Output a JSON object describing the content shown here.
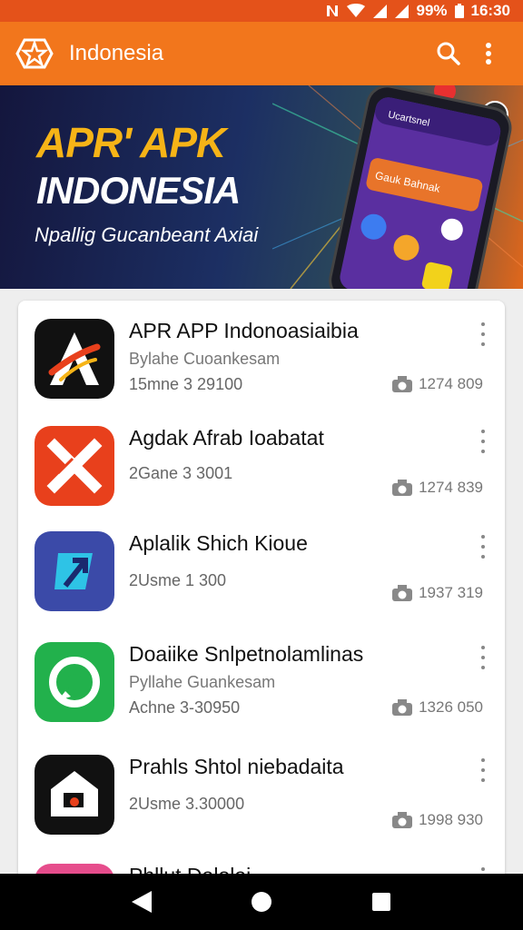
{
  "status_bar": {
    "battery": "99%",
    "time": "16:30"
  },
  "app_bar": {
    "title": "Indonesia",
    "logo_icon": "star-logo-icon",
    "search_icon": "search-icon",
    "menu_icon": "more-vert-icon"
  },
  "banner": {
    "title": "APR' APK",
    "subtitle": "INDONESIA",
    "tagline": "Npallig Gucanbeant Axiai",
    "phone_header": "Ucartsnel",
    "phone_card": "Gauk Bahnak"
  },
  "apps": [
    {
      "name": "APR APP Indonoasiaibia",
      "developer": "Bylahe Cuoankesam",
      "size": "15mne 3 29100",
      "count": "1274 809",
      "icon": "a-logo-icon",
      "color": "#111111"
    },
    {
      "name": "Agdak Afrab Ioabatat",
      "developer": "",
      "size": "2Gane 3 3001",
      "count": "1274 839",
      "icon": "x-logo-icon",
      "color": "#e8401c"
    },
    {
      "name": "Aplalik Shich Kioue",
      "developer": "",
      "size": "2Usme 1 300",
      "count": "1937 319",
      "icon": "arrow-logo-icon",
      "color": "#3b4aa8"
    },
    {
      "name": "Doaiike Snlpetnolamlinas",
      "developer": "Pyllahe Guankesam",
      "size": "Achne 3-30950",
      "count": "1326 050",
      "icon": "chat-logo-icon",
      "color": "#22b14c"
    },
    {
      "name": "Prahls Shtol niebadaita",
      "developer": "",
      "size": "2Usme 3.30000",
      "count": "1998 930",
      "icon": "house-logo-icon",
      "color": "#111111"
    },
    {
      "name": "Phllut Dalolai",
      "developer": "",
      "size": "",
      "count": "",
      "icon": "app-logo-icon",
      "color": "#e64d8c"
    }
  ],
  "nav": {
    "back": "back-icon",
    "home": "home-icon",
    "recents": "recents-icon"
  }
}
